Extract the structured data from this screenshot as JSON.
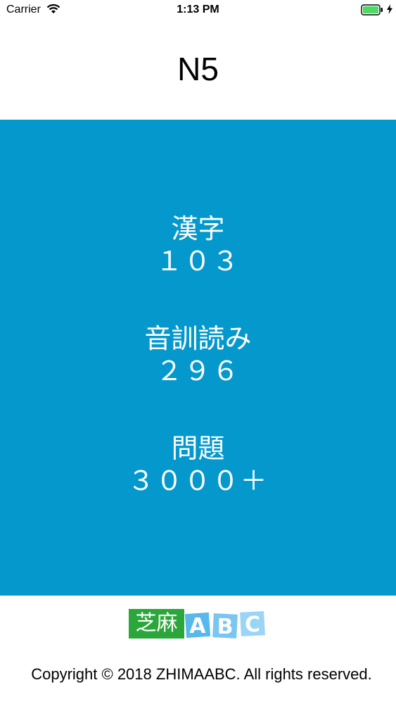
{
  "status": {
    "carrier": "Carrier",
    "time": "1:13 PM",
    "wifi_icon": "wifi-icon",
    "battery_icon": "battery-icon",
    "charging_icon": "bolt-icon"
  },
  "nav": {
    "title": "N5"
  },
  "colors": {
    "hero_bg": "#0498cc",
    "logo_green": "#2aa63a",
    "logo_blue": "#3fa6e6"
  },
  "stats": [
    {
      "label": "漢字",
      "value": "１０３"
    },
    {
      "label": "音訓読み",
      "value": "２９６"
    },
    {
      "label": "問題",
      "value": "３０００＋"
    }
  ],
  "logo": {
    "left_text": "芝麻",
    "letters": [
      "A",
      "B",
      "C"
    ]
  },
  "footer": {
    "copyright": "Copyright © 2018 ZHIMAABC. All rights reserved."
  }
}
